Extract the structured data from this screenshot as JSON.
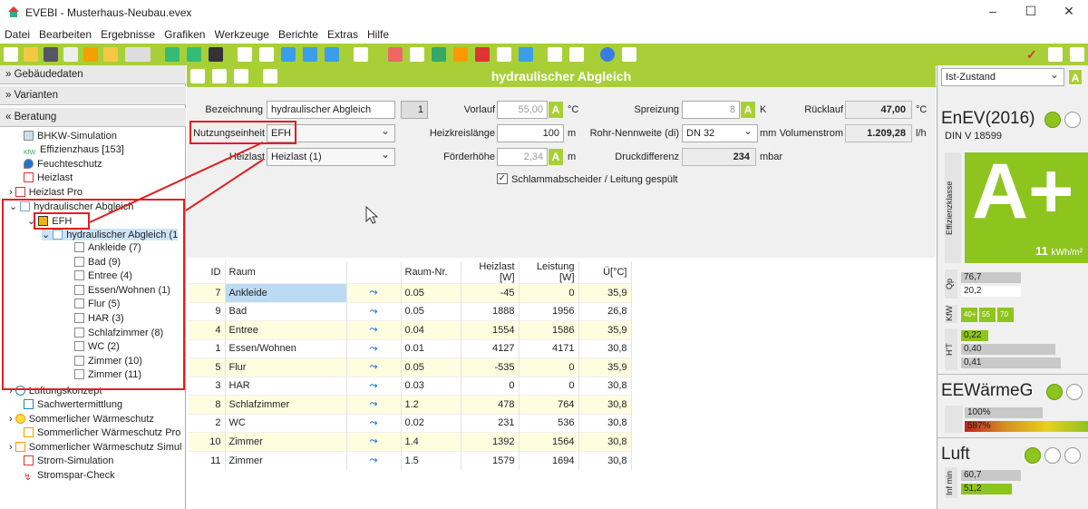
{
  "window": {
    "title": "EVEBI - Musterhaus-Neubau.evex"
  },
  "menu": [
    "Datei",
    "Bearbeiten",
    "Ergebnisse",
    "Grafiken",
    "Werkzeuge",
    "Berichte",
    "Extras",
    "Hilfe"
  ],
  "sidebar": {
    "sections": [
      "Gebäudedaten",
      "Varianten",
      "Beratung"
    ],
    "tree": [
      {
        "label": "BHKW-Simulation"
      },
      {
        "label": "Effizienzhaus [153]"
      },
      {
        "label": "Feuchteschutz"
      },
      {
        "label": "Heizlast"
      },
      {
        "label": "Heizlast Pro"
      },
      {
        "label": "hydraulischer Abgleich"
      },
      {
        "label": "EFH"
      },
      {
        "label": "hydraulischer Abgleich (1"
      },
      {
        "label": "Ankleide (7)"
      },
      {
        "label": "Bad (9)"
      },
      {
        "label": "Entree (4)"
      },
      {
        "label": "Essen/Wohnen (1)"
      },
      {
        "label": "Flur (5)"
      },
      {
        "label": "HAR (3)"
      },
      {
        "label": "Schlafzimmer (8)"
      },
      {
        "label": "WC (2)"
      },
      {
        "label": "Zimmer (10)"
      },
      {
        "label": "Zimmer (11)"
      },
      {
        "label": "Lüftungskonzept"
      },
      {
        "label": "Sachwertermittlung"
      },
      {
        "label": "Sommerlicher Wärmeschutz"
      },
      {
        "label": "Sommerlicher Wärmeschutz Pro"
      },
      {
        "label": "Sommerlicher Wärmeschutz Simul"
      },
      {
        "label": "Strom-Simulation"
      },
      {
        "label": "Stromspar-Check"
      }
    ]
  },
  "panel": {
    "title": "hydraulischer Abgleich",
    "bezeichnung_label": "Bezeichnung",
    "bezeichnung": "hydraulischer Abgleich",
    "index": "1",
    "nutzung_label": "Nutzungseinheit",
    "nutzung": "EFH",
    "heizlast_label": "Heizlast",
    "heizlast": "Heizlast (1)",
    "vorlauf_label": "Vorlauf",
    "vorlauf": "55,00",
    "unit_c": "°C",
    "heizkreis_label": "Heizkreislänge",
    "heizkreis": "100",
    "unit_m": "m",
    "foerder_label": "Förderhöhe",
    "foerder": "2,34",
    "spreizung_label": "Spreizung",
    "spreizung": "8",
    "unit_k": "K",
    "rohr_label": "Rohr-Nennweite (di)",
    "rohr": "DN 32",
    "unit_mm": "mm",
    "druck_label": "Druckdifferenz",
    "druck": "234",
    "unit_mbar": "mbar",
    "ruecklauf_label": "Rücklauf",
    "ruecklauf": "47,00",
    "vstrom_label": "Volumenstrom",
    "vstrom": "1.209,28",
    "unit_lh": "l/h",
    "schlamm": "Schlammabscheider / Leitung gespült",
    "a_badge": "A"
  },
  "table": {
    "headers": [
      "ID",
      "Raum",
      "",
      "Raum-Nr.",
      "Heizlast [W]",
      "Leistung [W]",
      "Ü[°C]"
    ],
    "rows": [
      [
        "7",
        "Ankleide",
        "0.05",
        "-45",
        "0",
        "35,9"
      ],
      [
        "9",
        "Bad",
        "0.05",
        "1888",
        "1956",
        "26,8"
      ],
      [
        "4",
        "Entree",
        "0.04",
        "1554",
        "1586",
        "35,9"
      ],
      [
        "1",
        "Essen/Wohnen",
        "0.01",
        "4127",
        "4171",
        "30,8"
      ],
      [
        "5",
        "Flur",
        "0.05",
        "-535",
        "0",
        "35,9"
      ],
      [
        "3",
        "HAR",
        "0.03",
        "0",
        "0",
        "30,8"
      ],
      [
        "8",
        "Schlafzimmer",
        "1.2",
        "478",
        "764",
        "30,8"
      ],
      [
        "2",
        "WC",
        "0.02",
        "231",
        "536",
        "30,8"
      ],
      [
        "10",
        "Zimmer",
        "1.4",
        "1392",
        "1564",
        "30,8"
      ],
      [
        "11",
        "Zimmer",
        "1.5",
        "1579",
        "1694",
        "30,8"
      ]
    ]
  },
  "right": {
    "zustand": "Ist-Zustand",
    "enev": "EnEV(2016)",
    "din": "DIN V 18599",
    "klasse": "A+",
    "klasse_label": "Effizienzklasse",
    "kwh": "11",
    "kwh_unit": "kWh/m²",
    "qp_label": "Qp",
    "qp1": "76,7",
    "qp2": "20,2",
    "kfw_label": "KfW",
    "kfw": [
      "40+",
      "55",
      "70"
    ],
    "ht_label": "H'T",
    "ht": [
      "0,22",
      "0,40",
      "0,41"
    ],
    "eew": "EEWärmeG",
    "eew1": "100%",
    "eew2": "587%",
    "luft": "Luft",
    "inf_label": "Inf min",
    "luft1": "60,7",
    "luft2": "51,2"
  }
}
